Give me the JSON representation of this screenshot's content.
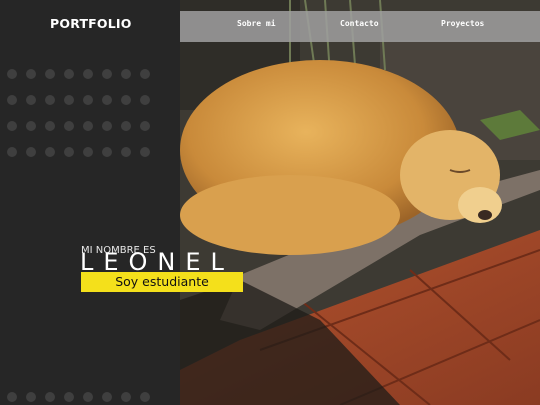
{
  "brand": {
    "logo": "PORTFOLIO"
  },
  "nav": {
    "items": [
      {
        "label": "Sobre mi"
      },
      {
        "label": "Contacto"
      },
      {
        "label": "Proyectos"
      }
    ]
  },
  "hero": {
    "intro": "MI NOMBRE ES",
    "name": "LEONEL",
    "tagline": "Soy estudiante"
  },
  "colors": {
    "panel": "#262626",
    "navbar": "#a0a0a0",
    "badge": "#f4e01b"
  }
}
